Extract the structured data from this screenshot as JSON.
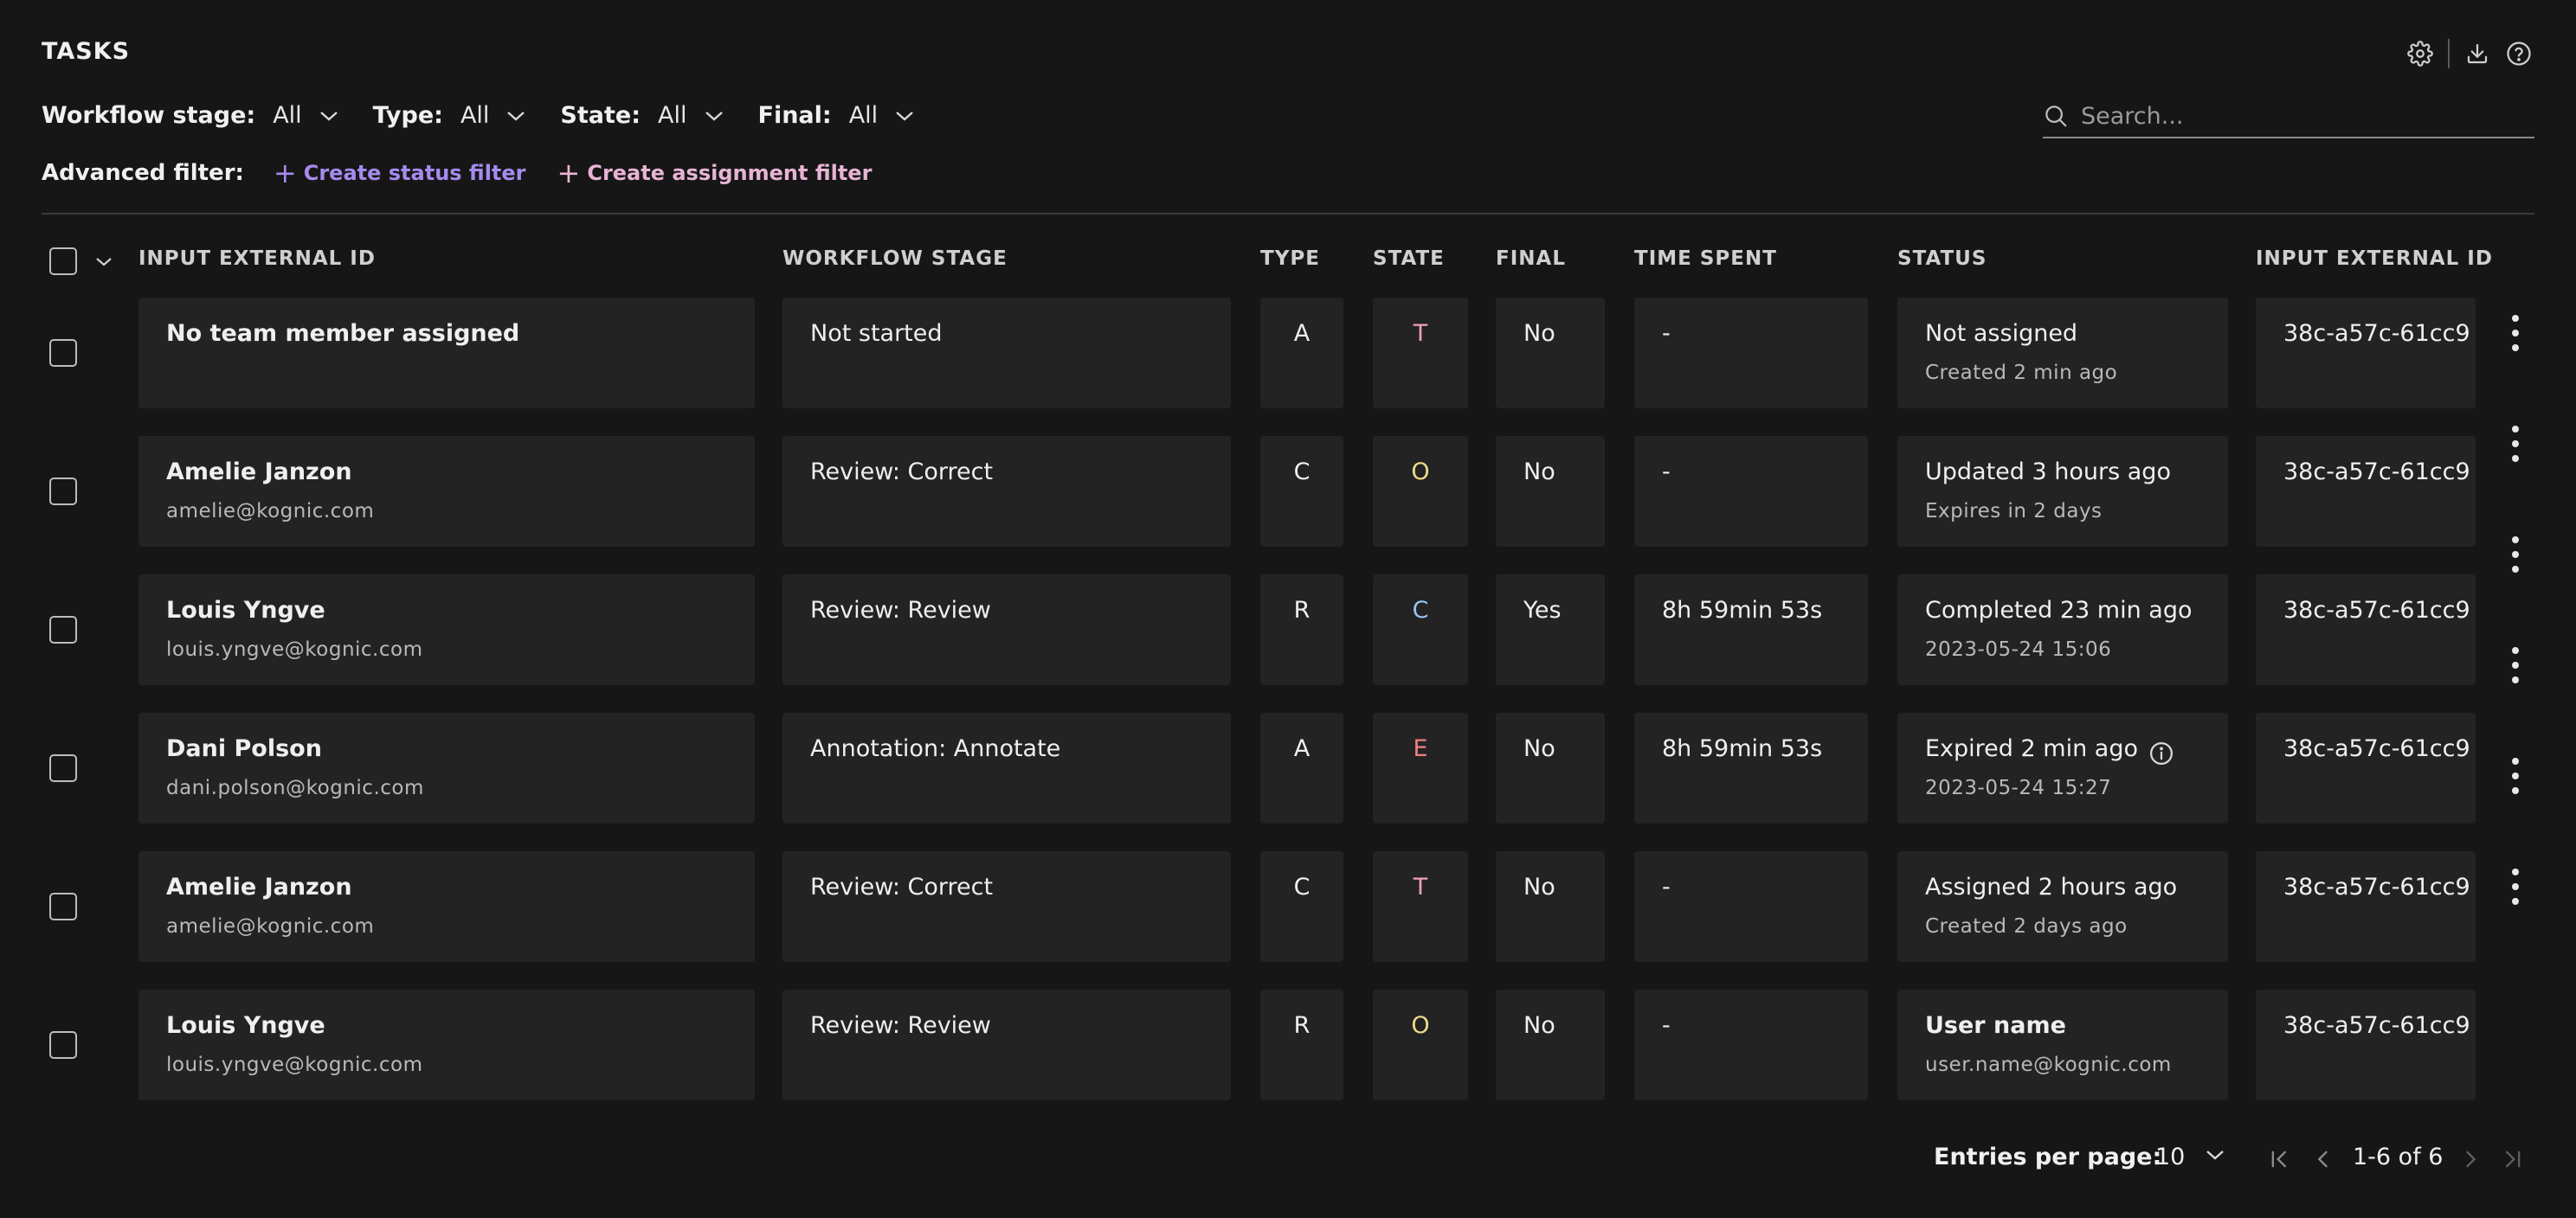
{
  "header": {
    "title": "TASKS",
    "icons": [
      "gear-icon",
      "download-icon",
      "help-icon"
    ]
  },
  "filters": [
    {
      "label": "Workflow stage:",
      "value": "All"
    },
    {
      "label": "Type:",
      "value": "All"
    },
    {
      "label": "State:",
      "value": "All"
    },
    {
      "label": "Final:",
      "value": "All"
    }
  ],
  "search": {
    "placeholder": "Search..."
  },
  "advanced_filter": {
    "label": "Advanced filter:",
    "status_filter": "Create status filter",
    "assignment_filter": "Create assignment filter"
  },
  "columns": {
    "input_external_id": "INPUT EXTERNAL ID",
    "workflow_stage": "WORKFLOW STAGE",
    "type": "TYPE",
    "state": "STATE",
    "final": "FINAL",
    "time_spent": "TIME SPENT",
    "status": "STATUS",
    "input_external_id_2": "INPUT EXTERNAL ID"
  },
  "rows": [
    {
      "name": "No team member assigned",
      "email": "",
      "stage": "Not started",
      "type": "A",
      "state": "T",
      "final": "No",
      "time": "-",
      "status": "Not assigned",
      "status_sub": "Created 2 min ago",
      "status_bold": false,
      "external_id": "38c-a57c-61cc9"
    },
    {
      "name": "Amelie Janzon",
      "email": "amelie@kognic.com",
      "stage": "Review: Correct",
      "type": "C",
      "state": "O",
      "final": "No",
      "time": "-",
      "status": "Updated 3 hours ago",
      "status_sub": "Expires in 2 days",
      "status_bold": false,
      "external_id": "38c-a57c-61cc9"
    },
    {
      "name": "Louis Yngve",
      "email": "louis.yngve@kognic.com",
      "stage": "Review: Review",
      "type": "R",
      "state": "C",
      "final": "Yes",
      "time": "8h 59min 53s",
      "status": "Completed 23 min ago",
      "status_sub": "2023-05-24 15:06",
      "status_bold": false,
      "external_id": "38c-a57c-61cc9"
    },
    {
      "name": "Dani Polson",
      "email": "dani.polson@kognic.com",
      "stage": "Annotation: Annotate",
      "type": "A",
      "state": "E",
      "final": "No",
      "time": "8h 59min 53s",
      "status": "Expired 2 min ago",
      "status_sub": "2023-05-24 15:27",
      "status_bold": false,
      "external_id": "38c-a57c-61cc9",
      "has_info": true
    },
    {
      "name": "Amelie Janzon",
      "email": "amelie@kognic.com",
      "stage": "Review: Correct",
      "type": "C",
      "state": "T",
      "final": "No",
      "time": "-",
      "status": "Assigned 2 hours ago",
      "status_sub": "Created 2 days ago",
      "status_bold": false,
      "external_id": "38c-a57c-61cc9"
    },
    {
      "name": "Louis Yngve",
      "email": "louis.yngve@kognic.com",
      "stage": "Review: Review",
      "type": "R",
      "state": "O",
      "final": "No",
      "time": "-",
      "status": "User name",
      "status_sub": "user.name@kognic.com",
      "status_bold": true,
      "external_id": "38c-a57c-61cc9"
    }
  ],
  "state_colors": {
    "T": "#f0a0b8",
    "O": "#eddc8a",
    "C": "#94c4f2",
    "E": "#f08080"
  },
  "pagination": {
    "entries_label": "Entries per page:",
    "entries_value": "10",
    "range": "1-6 of 6"
  }
}
